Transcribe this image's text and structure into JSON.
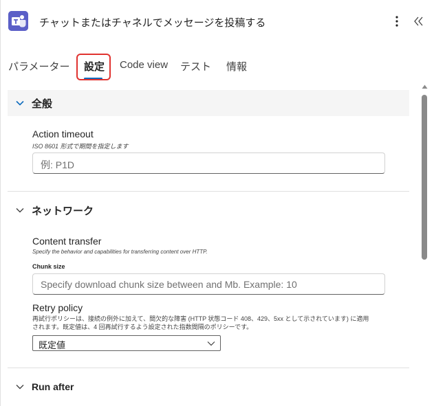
{
  "header": {
    "title": "チャットまたはチャネルでメッセージを投稿する",
    "app_icon": "teams-icon",
    "more_icon": "more-vertical-icon",
    "collapse_icon": "double-chevron-left-icon"
  },
  "tabs": [
    {
      "label": "パラメーター",
      "active": false
    },
    {
      "label": "設定",
      "active": true
    },
    {
      "label": "Code view",
      "active": false
    },
    {
      "label": "テスト",
      "active": false
    },
    {
      "label": "情報",
      "active": false
    }
  ],
  "sections": {
    "general": {
      "title": "全般",
      "action_timeout": {
        "label": "Action timeout",
        "hint": "ISO 8601 形式で期間を指定します",
        "placeholder": "例: P1D"
      }
    },
    "network": {
      "title": "ネットワーク",
      "content_transfer": {
        "label": "Content transfer",
        "hint": "Specify the behavior and capabilities for transferring content over HTTP.",
        "chunk_label": "Chunk size",
        "chunk_placeholder": "Specify download chunk size between  and  Mb. Example: 10"
      },
      "retry_policy": {
        "label": "Retry policy",
        "description_line1": "再試行ポリシーは、接続の例外に加えて、間欠的な障害 (HTTP 状態コード 408、429、5xx として示されています) に適用",
        "description_line2": "されます。既定値は、4 回再試行するよう設定された指数間隔のポリシーです。",
        "selected": "既定値"
      }
    },
    "run_after": {
      "title": "Run after"
    }
  },
  "colors": {
    "accent": "#0f6cbd",
    "highlight_border": "#e0322f",
    "teams_purple": "#5b5fc7"
  }
}
